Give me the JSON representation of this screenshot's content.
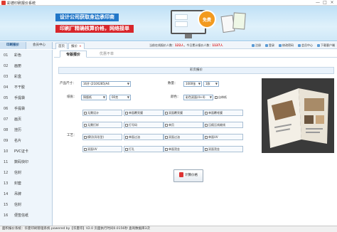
{
  "window": {
    "title": "彩德印刷报价系统",
    "controls": [
      "—",
      "□",
      "×"
    ]
  },
  "banner": {
    "slogan_primary": "设计公司获取身边承印商",
    "slogan_secondary": "印刷厂精确核算价格，网络接单",
    "badge": "免费",
    "colors": {
      "primary": "#2277c8",
      "secondary": "#d8262b",
      "badge": "#f29a1f"
    }
  },
  "toolbar": {
    "side_title_left": "印刷报价",
    "side_title_right": "会员中心",
    "tabs": [
      {
        "label": "首页",
        "closable": false
      },
      {
        "label": "报价",
        "closable": true
      }
    ],
    "notice_prefix": "当前在线报价人数：",
    "online_count": "122人",
    "notice_middle": "，今日累计报价人数：",
    "today_count": "1137人",
    "links": [
      {
        "label": "注册",
        "icon": "user-plus-icon"
      },
      {
        "label": "登录",
        "icon": "login-icon"
      },
      {
        "label": "修改密码",
        "icon": "key-icon"
      },
      {
        "label": "会员中心",
        "icon": "member-icon"
      },
      {
        "label": "下载客户端",
        "icon": "download-icon"
      }
    ]
  },
  "sidebar": {
    "items": [
      {
        "num": "01",
        "label": "彩色"
      },
      {
        "num": "02",
        "label": "画册"
      },
      {
        "num": "03",
        "label": "彩盒"
      },
      {
        "num": "04",
        "label": "不干胶"
      },
      {
        "num": "05",
        "label": "手提袋"
      },
      {
        "num": "06",
        "label": "手提袋"
      },
      {
        "num": "07",
        "label": "画页"
      },
      {
        "num": "08",
        "label": "挂历"
      },
      {
        "num": "09",
        "label": "名片"
      },
      {
        "num": "10",
        "label": "PVC证卡"
      },
      {
        "num": "11",
        "label": "数码快印"
      },
      {
        "num": "12",
        "label": "信封"
      },
      {
        "num": "13",
        "label": "封套"
      },
      {
        "num": "14",
        "label": "吊牌"
      },
      {
        "num": "15",
        "label": "信封"
      },
      {
        "num": "16",
        "label": "便签信纸"
      }
    ]
  },
  "main": {
    "subtabs": {
      "active": "专版报价",
      "inactive": "优惠不单"
    },
    "section_title": "彩页报价",
    "form": {
      "size_label": "产品尺寸：",
      "size_value": "16开 (210X285)A4",
      "qty_label": "数量：",
      "qty_value": "1000张",
      "qty_unit": "1款",
      "paper_label": "纸张：",
      "paper_value": "铜版纸",
      "weight_value": "00克",
      "color_label": "颜色：",
      "color_value": "彩色双面(4+4)",
      "custom_paper_label": "自带纸",
      "process_label": "工艺："
    },
    "processes": [
      "无需设计",
      "单面覆亮膜",
      "双面覆亮膜",
      "单面覆哑膜",
      "无需打样",
      "打号码",
      "单页",
      "压痕压线裁线",
      "模切(异形型)",
      "单面过油",
      "双面过油",
      "单面UV",
      "双面UV",
      "打孔",
      "单面烫金",
      "双面烫金"
    ],
    "calc_button": "计算价格"
  },
  "statusbar": {
    "text": "面积报价系统：华夏印刷管理系统 powered by【华夏印】V2.0 页面执行时间0.0156秒 查询数据库3次"
  }
}
